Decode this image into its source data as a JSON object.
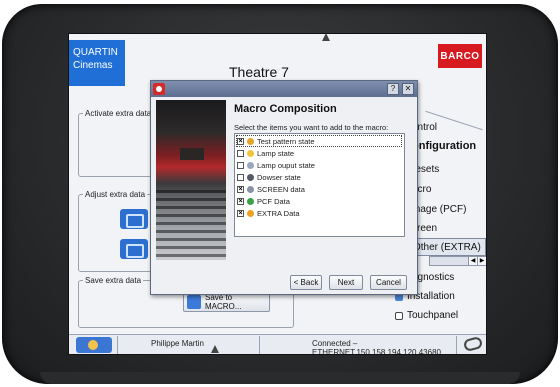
{
  "app": {
    "brand_left": "QUARTIN Cinemas",
    "brand_right": "BARCO",
    "title": "Theatre 7",
    "colors": {
      "quartin": "#1f6fd6",
      "barco": "#d71920",
      "dialog_titlebar": "#6272a0"
    }
  },
  "groups": {
    "activate": "Activate extra data",
    "adjust": "Adjust extra data",
    "save": "Save extra data"
  },
  "adjust_items": [
    {
      "icon": "network-icon",
      "label": "In"
    },
    {
      "icon": "network-icon",
      "label": "A"
    }
  ],
  "save_button": "Save to MACRO...",
  "menu": [
    {
      "label": "ontrol",
      "bold": false
    },
    {
      "label": "onfiguration",
      "bold": true
    },
    {
      "label": "resets",
      "bold": false
    },
    {
      "label": "acro",
      "bold": false
    },
    {
      "label": "mage (PCF)",
      "bold": false
    },
    {
      "label": "creen",
      "bold": false
    },
    {
      "label": "Other (EXTRA)",
      "bold": false,
      "selected": true
    },
    {
      "label": "agnostics",
      "bold": false
    },
    {
      "label": "Installation",
      "bold": false
    },
    {
      "label": "Touchpanel",
      "bold": false
    }
  ],
  "status": {
    "user": "Philippe Martin",
    "connection": "Connected  –  ETHERNET,150.158.194.120,43680"
  },
  "dialog": {
    "help": "?",
    "close": "✕",
    "heading": "Macro Composition",
    "prompt": "Select the items you want to add to the macro:",
    "items": [
      {
        "label": "Test pattern state",
        "checked": true,
        "icon": "test-pattern-icon",
        "color": "#e6a526"
      },
      {
        "label": "Lamp state",
        "checked": false,
        "icon": "lamp-icon",
        "color": "#f0c53a"
      },
      {
        "label": "Lamp ouput state",
        "checked": false,
        "icon": "lamp-output-icon",
        "color": "#9aa6c0"
      },
      {
        "label": "Dowser state",
        "checked": false,
        "icon": "dowser-icon",
        "color": "#555b66"
      },
      {
        "label": "SCREEN data",
        "checked": true,
        "icon": "screen-icon",
        "color": "#8a93a6"
      },
      {
        "label": "PCF Data",
        "checked": true,
        "icon": "pcf-icon",
        "color": "#3aa04a"
      },
      {
        "label": "EXTRA Data",
        "checked": true,
        "icon": "extra-icon",
        "color": "#f0a020"
      }
    ],
    "buttons": {
      "back": "< Back",
      "next": "Next",
      "cancel": "Cancel"
    }
  }
}
